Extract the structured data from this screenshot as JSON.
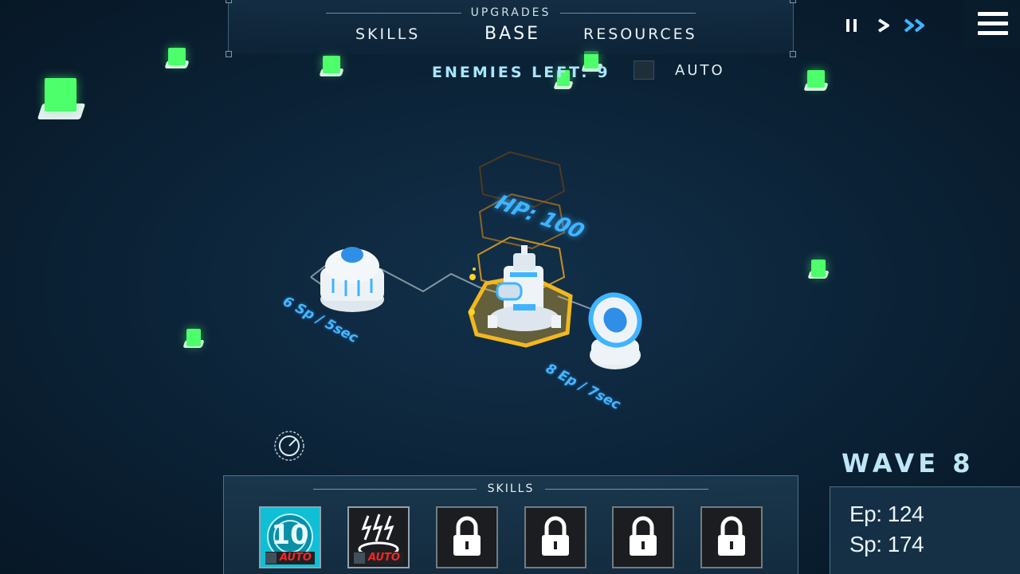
{
  "top_menu": {
    "title": "UPGRADES",
    "tabs": {
      "skills": "SKILLS",
      "base": "BASE",
      "resources": "RESOURCES"
    }
  },
  "enemies_left": "ENEMIES LEFT: 9",
  "auto_label": "AUTO",
  "playback": {
    "pause_icon": "pause-icon",
    "play_icon": "play-icon",
    "fast_forward_icon": "fast-forward-icon",
    "menu_icon": "hamburger-menu-icon"
  },
  "base": {
    "hp_label": "HP: 100"
  },
  "generators": {
    "sp_rate": "6 Sp / 5sec",
    "ep_rate": "8 Ep / 7sec"
  },
  "skills_panel": {
    "title": "SKILLS",
    "slots": [
      {
        "icon": "countdown-shield-icon",
        "number": "10",
        "auto": "AUTO",
        "locked": false
      },
      {
        "icon": "lightning-strike-icon",
        "auto": "AUTO",
        "locked": false
      },
      {
        "icon": "lock-icon",
        "locked": true
      },
      {
        "icon": "lock-icon",
        "locked": true
      },
      {
        "icon": "lock-icon",
        "locked": true
      },
      {
        "icon": "lock-icon",
        "locked": true
      }
    ]
  },
  "wave": "WAVE 8",
  "resources": {
    "ep": "Ep: 124",
    "sp": "Sp: 174"
  },
  "colors": {
    "accent": "#3fb4ff",
    "enemy": "#4dff6a",
    "highlight": "#f2b81e",
    "auto_red": "#ff2424"
  }
}
